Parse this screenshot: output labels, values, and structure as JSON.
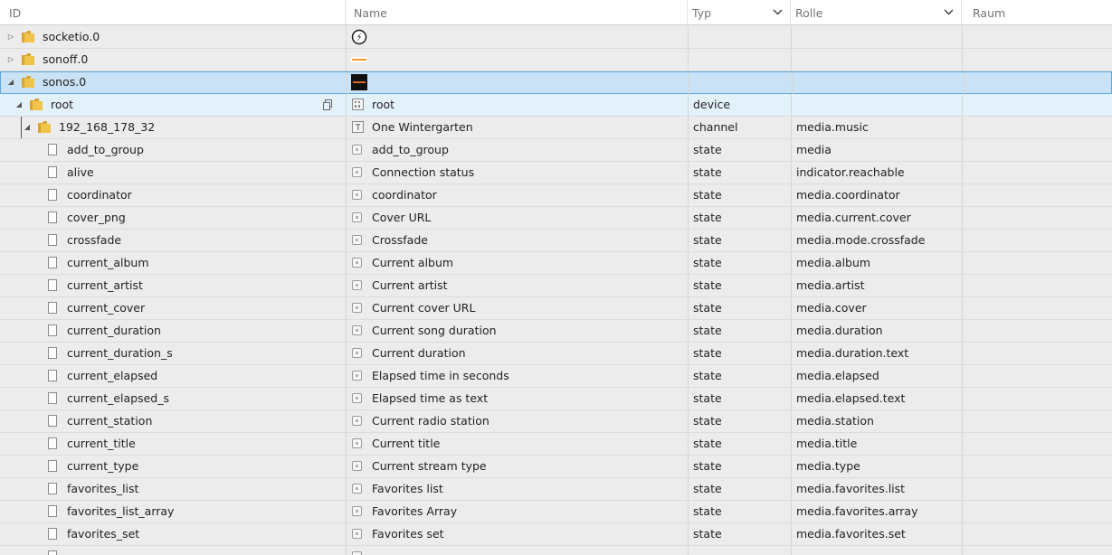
{
  "header": {
    "id": "ID",
    "name": "Name",
    "typ": "Typ",
    "rolle": "Rolle",
    "raum": "Raum"
  },
  "rows": [
    {
      "id": "socketio.0",
      "name": "",
      "typ": "",
      "rolle": "",
      "raum": ""
    },
    {
      "id": "sonoff.0",
      "name": "",
      "typ": "",
      "rolle": "",
      "raum": ""
    },
    {
      "id": "sonos.0",
      "name": "",
      "typ": "",
      "rolle": "",
      "raum": ""
    },
    {
      "id": "root",
      "name": "root",
      "typ": "device",
      "rolle": "",
      "raum": ""
    },
    {
      "id": "192_168_178_32",
      "name": "One Wintergarten",
      "typ": "channel",
      "rolle": "media.music",
      "raum": ""
    },
    {
      "id": "add_to_group",
      "name": "add_to_group",
      "typ": "state",
      "rolle": "media",
      "raum": ""
    },
    {
      "id": "alive",
      "name": "Connection status",
      "typ": "state",
      "rolle": "indicator.reachable",
      "raum": ""
    },
    {
      "id": "coordinator",
      "name": "coordinator",
      "typ": "state",
      "rolle": "media.coordinator",
      "raum": ""
    },
    {
      "id": "cover_png",
      "name": "Cover URL",
      "typ": "state",
      "rolle": "media.current.cover",
      "raum": ""
    },
    {
      "id": "crossfade",
      "name": "Crossfade",
      "typ": "state",
      "rolle": "media.mode.crossfade",
      "raum": ""
    },
    {
      "id": "current_album",
      "name": "Current album",
      "typ": "state",
      "rolle": "media.album",
      "raum": ""
    },
    {
      "id": "current_artist",
      "name": "Current artist",
      "typ": "state",
      "rolle": "media.artist",
      "raum": ""
    },
    {
      "id": "current_cover",
      "name": "Current cover URL",
      "typ": "state",
      "rolle": "media.cover",
      "raum": ""
    },
    {
      "id": "current_duration",
      "name": "Current song duration",
      "typ": "state",
      "rolle": "media.duration",
      "raum": ""
    },
    {
      "id": "current_duration_s",
      "name": "Current duration",
      "typ": "state",
      "rolle": "media.duration.text",
      "raum": ""
    },
    {
      "id": "current_elapsed",
      "name": "Elapsed time in seconds",
      "typ": "state",
      "rolle": "media.elapsed",
      "raum": ""
    },
    {
      "id": "current_elapsed_s",
      "name": "Elapsed time as text",
      "typ": "state",
      "rolle": "media.elapsed.text",
      "raum": ""
    },
    {
      "id": "current_station",
      "name": "Current radio station",
      "typ": "state",
      "rolle": "media.station",
      "raum": ""
    },
    {
      "id": "current_title",
      "name": "Current title",
      "typ": "state",
      "rolle": "media.title",
      "raum": ""
    },
    {
      "id": "current_type",
      "name": "Current stream type",
      "typ": "state",
      "rolle": "media.type",
      "raum": ""
    },
    {
      "id": "favorites_list",
      "name": "Favorites list",
      "typ": "state",
      "rolle": "media.favorites.list",
      "raum": ""
    },
    {
      "id": "favorites_list_array",
      "name": "Favorites Array",
      "typ": "state",
      "rolle": "media.favorites.array",
      "raum": ""
    },
    {
      "id": "favorites_set",
      "name": "Favorites set",
      "typ": "state",
      "rolle": "media.favorites.set",
      "raum": ""
    }
  ],
  "colors": {
    "selected_row": "#c9e2f5",
    "selected_border": "#5aa6dc",
    "hover_row": "#e3f1fb",
    "folder": "#e6b93a",
    "background": "#ececec"
  },
  "icons": {
    "expanded": "triangle-down-icon",
    "collapsed": "triangle-right-icon",
    "folder": "folder-icon",
    "file": "file-icon",
    "state": "state-icon",
    "copy": "copy-icon",
    "dropdown": "chevron-down-icon"
  }
}
